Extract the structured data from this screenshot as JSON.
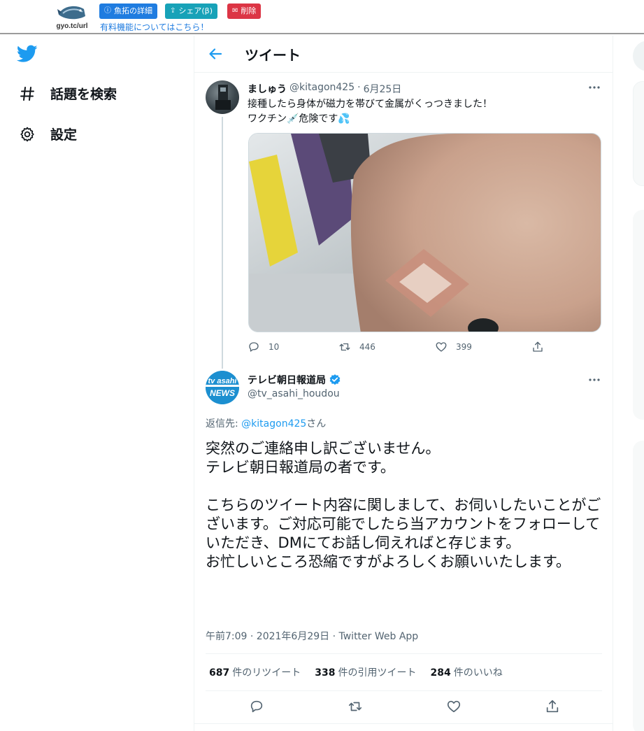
{
  "gyotaku": {
    "logo_text": "gyo.tc/url",
    "detail_label": "魚拓の詳細",
    "share_label": "シェア(β)",
    "delete_label": "削除",
    "paid_link": "有料機能についてはこちら！"
  },
  "nav": {
    "explore_label": "話題を検索",
    "settings_label": "設定"
  },
  "header": {
    "title": "ツイート"
  },
  "parent_tweet": {
    "name": "ましゅう",
    "handle": "@kitagon425",
    "separator": "·",
    "date": "6月25日",
    "text_line1": "接種したら身体が磁力を帯びて金属がくっつきました！",
    "text_line2": "ワクチン💉危険です💦",
    "replies": "10",
    "retweets": "446",
    "likes": "399"
  },
  "main_tweet": {
    "name": "テレビ朝日報道局",
    "handle": "@tv_asahi_houdou",
    "avatar_text_top": "tv asahi",
    "avatar_text_bottom": "NEWS",
    "reply_to_prefix": "返信先: ",
    "reply_to_mention": "@kitagon425",
    "reply_to_suffix": "さん",
    "body": "突然のご連絡申し訳ございません。\nテレビ朝日報道局の者です。\n\nこちらのツイート内容に関しまして、お伺いしたいことがございます。ご対応可能でしたら当アカウントをフォローしていただき、DMにてお話し伺えればと存じます。\nお忙しいところ恐縮ですがよろしくお願いいたします。",
    "meta": "午前7:09 · 2021年6月29日 · Twitter Web App",
    "retweet_count": "687",
    "retweet_label": "件のリツイート",
    "quote_count": "338",
    "quote_label": "件の引用ツイート",
    "like_count": "284",
    "like_label": "件のいいね"
  },
  "colors": {
    "twitter_blue": "#1d9bf0",
    "gyotaku_detail": "#1f7ce0",
    "gyotaku_share": "#17a2b8",
    "gyotaku_delete": "#dc3545"
  }
}
